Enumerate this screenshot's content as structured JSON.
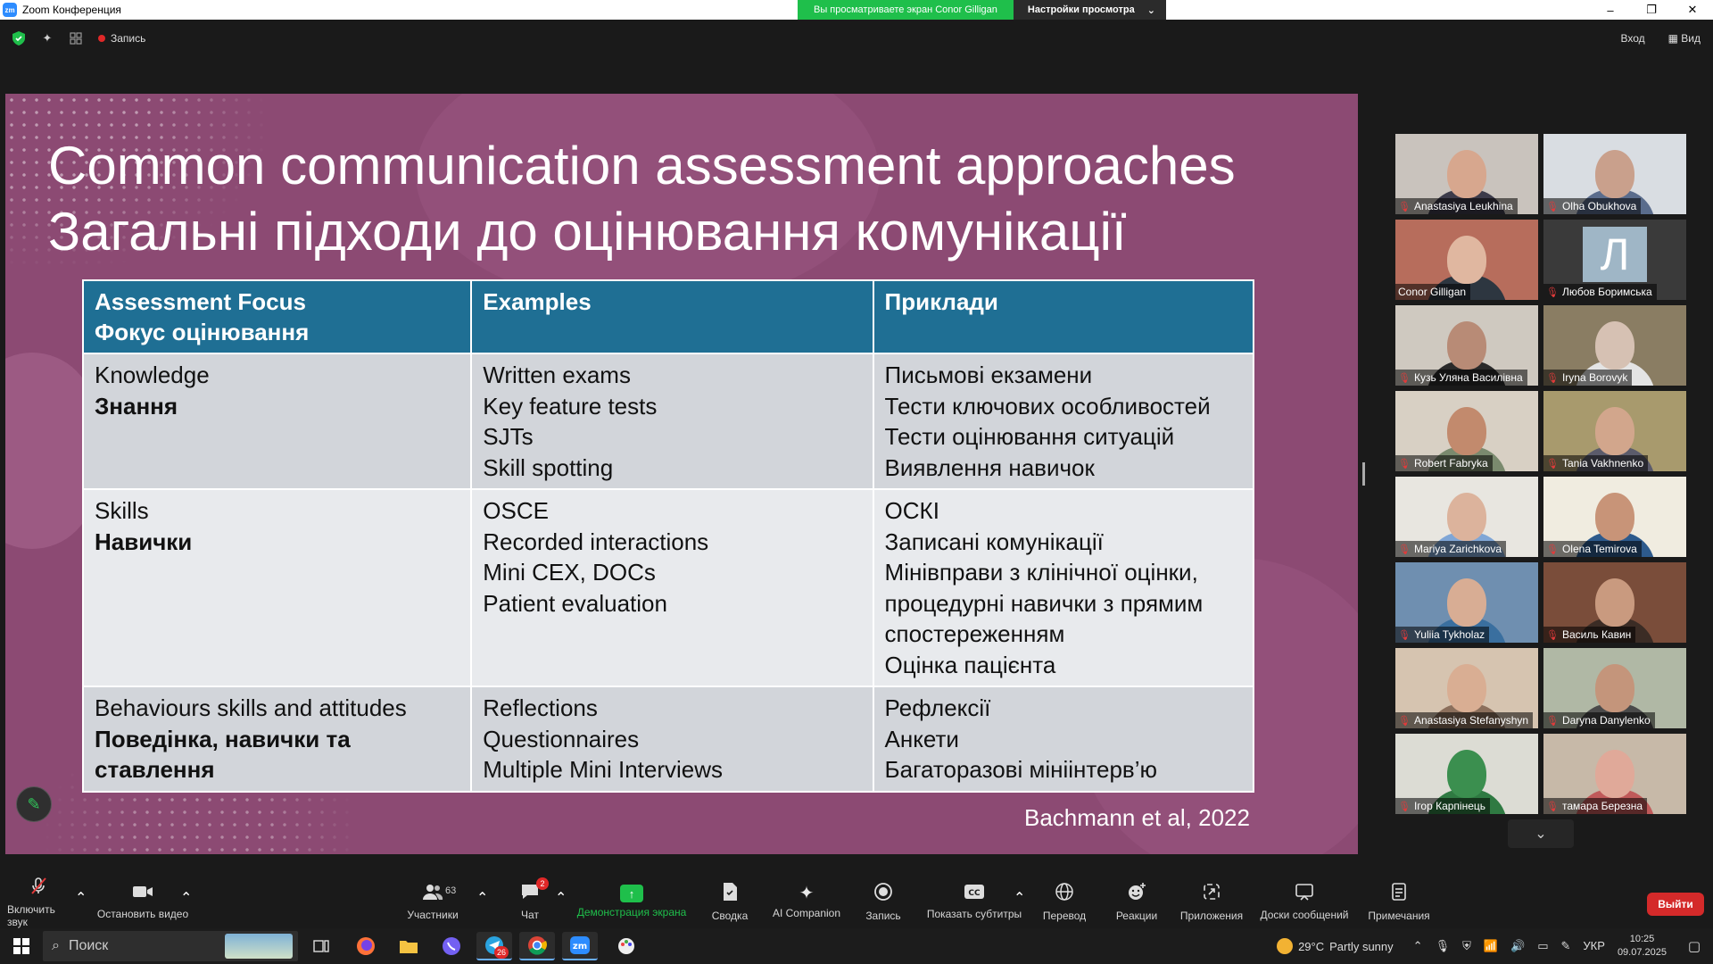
{
  "window": {
    "title": "Zoom Конференция",
    "app_logo": "zm",
    "share_banner": "Вы просматриваете экран Conor Gilligan",
    "view_settings": "Настройки просмотра",
    "controls": [
      "–",
      "❐",
      "✕"
    ]
  },
  "topbar": {
    "record_label": "Запись",
    "signin_label": "Вход",
    "view_label": "Вид"
  },
  "slide": {
    "title_en": "Common communication assessment approaches",
    "title_uk": "Загальні підходи до оцінювання комунікації",
    "headers": [
      {
        "lines": [
          "Assessment Focus",
          "Фокус оцінювання"
        ]
      },
      {
        "lines": [
          "Examples"
        ]
      },
      {
        "lines": [
          "Приклади"
        ]
      }
    ],
    "rows": [
      {
        "focus_en": "Knowledge",
        "focus_uk": "Знання",
        "examples": [
          "Written exams",
          "Key feature tests",
          "SJTs",
          "Skill spotting"
        ],
        "examples_uk": [
          "Письмові екзамени",
          "Тести ключових особливостей",
          "Тести оцінювання ситуацій",
          "Виявлення навичок"
        ]
      },
      {
        "focus_en": "Skills",
        "focus_uk": "Навички",
        "examples": [
          "OSCE",
          "Recorded interactions",
          "Mini CEX, DOCs",
          "Patient evaluation"
        ],
        "examples_uk": [
          "ОСКІ",
          "Записані комунікації",
          "Мінівправи з клінічної оцінки, процедурні навички з прямим спостереженням",
          "Оцінка пацієнта"
        ]
      },
      {
        "focus_en": "Behaviours skills and attitudes",
        "focus_uk": "Поведінка, навички та ставлення",
        "examples": [
          "Reflections",
          "Questionnaires",
          "Multiple Mini Interviews"
        ],
        "examples_uk": [
          "Рефлексії",
          "Анкети",
          "Багаторазові мініінтерв’ю"
        ]
      }
    ],
    "citation": "Bachmann et al, 2022"
  },
  "participants": [
    {
      "name": "Anastasiya Leukhina",
      "bg": "#c9c3bd",
      "skin": "#d7a78e",
      "shirt": "#3c3b4a"
    },
    {
      "name": "Olha Obukhova",
      "bg": "#d9dde2",
      "skin": "#c9a08c",
      "shirt": "#5a6c8c"
    },
    {
      "name": "Conor Gilligan",
      "bg": "#b76d5c",
      "skin": "#e0b7a0",
      "shirt": "#2d3640",
      "active": true
    },
    {
      "name": "Любов Боримська",
      "initial": "Л",
      "bg": "#3a3a3a"
    },
    {
      "name": "Кузь Уляна Василівна",
      "bg": "#cfc9c0",
      "skin": "#b88b76",
      "shirt": "#2a2a2a"
    },
    {
      "name": "Iryna Borovyk",
      "bg": "#8a7d63",
      "skin": "#d6c1b3",
      "shirt": "#e4e4e4"
    },
    {
      "name": "Robert Fabryka",
      "bg": "#d8d0c4",
      "skin": "#c28a6d",
      "shirt": "#7a8a6e"
    },
    {
      "name": "Tania Vakhnenko",
      "bg": "#a89a6d",
      "skin": "#d2a68c",
      "shirt": "#5b5b6b"
    },
    {
      "name": "Mariya Zarichkova",
      "bg": "#e8e6e0",
      "skin": "#dcb39c",
      "shirt": "#7fa6d6"
    },
    {
      "name": "Olena Temirova",
      "bg": "#f0ece0",
      "skin": "#c89478",
      "shirt": "#2d5a8c"
    },
    {
      "name": "Yuliia Tykholaz",
      "bg": "#6f8fb0",
      "skin": "#d8ad94",
      "shirt": "#3a6f9f"
    },
    {
      "name": "Василь Кавин",
      "bg": "#7a4d3a",
      "skin": "#c99a7f",
      "shirt": "#3b2c25"
    },
    {
      "name": "Anastasiya Stefanyshyn",
      "bg": "#d6c4b0",
      "skin": "#d9ae93",
      "shirt": "#8b6f5c"
    },
    {
      "name": "Daryna Danylenko",
      "bg": "#b0b8a5",
      "skin": "#c4957b",
      "shirt": "#4a4a4a"
    },
    {
      "name": "Ігор Карпінець",
      "bg": "#dcdcd4",
      "skin": "#3b8f4f",
      "shirt": "#2f7a42"
    },
    {
      "name": "тамара Березна",
      "bg": "#c7b9a8",
      "skin": "#e0a999",
      "shirt": "#c05a5a"
    }
  ],
  "toolbar": {
    "unmute": "Включить звук",
    "stop_video": "Остановить видео",
    "participants": "Участники",
    "participants_count": "63",
    "chat": "Чат",
    "chat_badge": "2",
    "share": "Демонстрация экрана",
    "summary": "Сводка",
    "ai": "AI Companion",
    "record": "Запись",
    "captions": "Показать субтитры",
    "translate": "Перевод",
    "reactions": "Реакции",
    "apps": "Приложения",
    "whiteboards": "Доски сообщений",
    "notes": "Примечания",
    "leave": "Выйти"
  },
  "taskbar": {
    "search_placeholder": "Поиск",
    "temperature": "29°C",
    "weather": "Partly sunny",
    "language": "УКР",
    "time": "10:25",
    "date": "09.07.2025",
    "telegram_badge": "26"
  }
}
